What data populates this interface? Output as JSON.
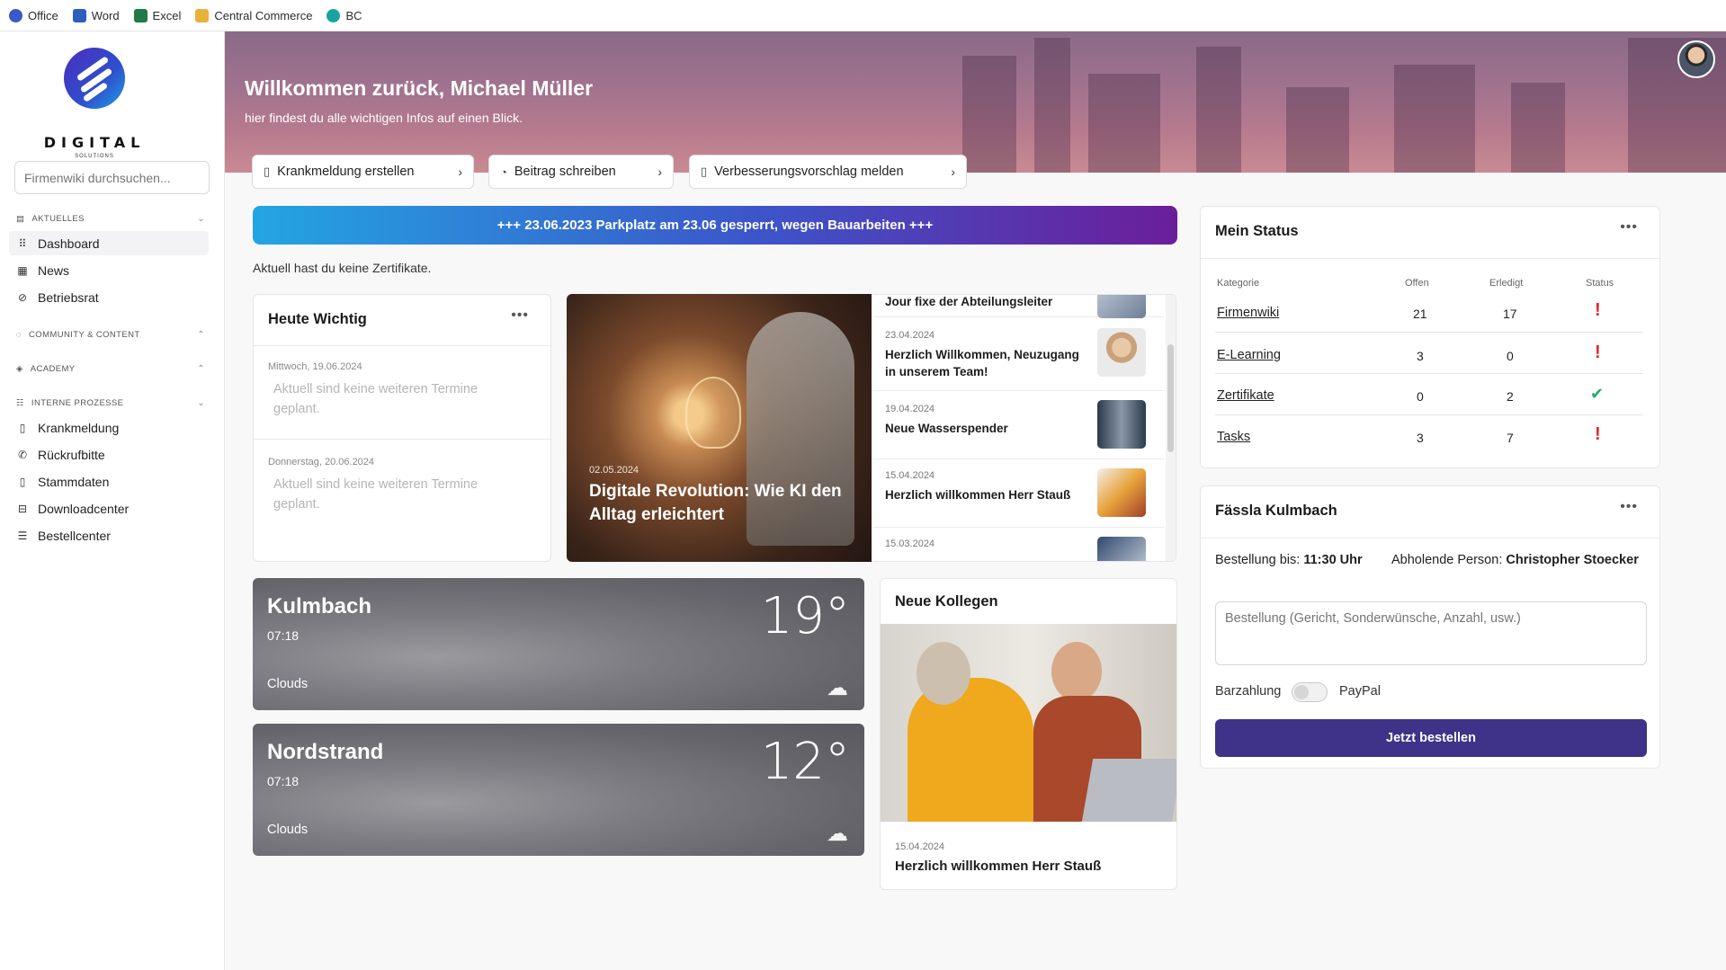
{
  "bookmarks": [
    {
      "label": "Office",
      "icon": "office-icon",
      "color": "#3b57c8"
    },
    {
      "label": "Word",
      "icon": "word-icon",
      "color": "#2b5fbe"
    },
    {
      "label": "Excel",
      "icon": "excel-icon",
      "color": "#1f7a45"
    },
    {
      "label": "Central Commerce",
      "icon": "folder-icon",
      "color": "#e8b23a"
    },
    {
      "label": "BC",
      "icon": "globe-icon",
      "color": "#1aa3a3"
    }
  ],
  "sidebar": {
    "logo_text": "DIGITAL",
    "logo_sub": "SOLUTIONS",
    "search_placeholder": "Firmenwiki durchsuchen...",
    "sections": [
      {
        "label": "AKTUELLES",
        "items": [
          "Dashboard",
          "News",
          "Betriebsrat"
        ]
      },
      {
        "label": "COMMUNITY & CONTENT",
        "items": []
      },
      {
        "label": "ACADEMY",
        "items": []
      },
      {
        "label": "INTERNE PROZESSE",
        "items": [
          "Krankmeldung",
          "Rückrufbitte",
          "Stammdaten",
          "Downloadcenter",
          "Bestellcenter"
        ]
      }
    ],
    "active_item": "Dashboard"
  },
  "hero": {
    "title": "Willkommen zurück, Michael Müller",
    "subtitle": "hier findest du alle wichtigen Infos auf einen Blick."
  },
  "quick_actions": [
    {
      "label": "Krankmeldung erstellen",
      "icon": "document-icon"
    },
    {
      "label": "Beitrag schreiben",
      "icon": "chat-icon"
    },
    {
      "label": "Verbesserungsvorschlag melden",
      "icon": "document-icon"
    }
  ],
  "announcement": "+++ 23.06.2023 Parkplatz am 23.06 gesperrt, wegen Bauarbeiten +++",
  "certificates_note": "Aktuell hast du keine Zertifikate.",
  "heute_wichtig": {
    "title": "Heute Wichtig",
    "entries": [
      {
        "date": "Mittwoch, 19.06.2024",
        "text": "Aktuell sind keine weiteren Termine geplant."
      },
      {
        "date": "Donnerstag, 20.06.2024",
        "text": "Aktuell sind keine weiteren Termine geplant."
      }
    ]
  },
  "news": {
    "featured": {
      "date": "02.05.2024",
      "title": "Digitale Revolution: Wie KI den Alltag erleichtert"
    },
    "items": [
      {
        "date": "",
        "title": "Jour fixe der Abteilungsleiter"
      },
      {
        "date": "23.04.2024",
        "title": "Herzlich Willkommen, Neuzugang in unserem Team!"
      },
      {
        "date": "19.04.2024",
        "title": "Neue Wasserspender"
      },
      {
        "date": "15.04.2024",
        "title": "Herzlich willkommen Herr Stauß"
      },
      {
        "date": "15.03.2024",
        "title": ""
      }
    ]
  },
  "weather": [
    {
      "city": "Kulmbach",
      "time": "07:18",
      "condition": "Clouds",
      "temp": "19°"
    },
    {
      "city": "Nordstrand",
      "time": "07:18",
      "condition": "Clouds",
      "temp": "12°"
    }
  ],
  "neue_kollegen": {
    "title": "Neue Kollegen",
    "date": "15.04.2024",
    "name": "Herzlich willkommen Herr Stauß"
  },
  "status": {
    "title": "Mein Status",
    "headers": {
      "category": "Kategorie",
      "open": "Offen",
      "done": "Erledigt",
      "status": "Status"
    },
    "rows": [
      {
        "category": "Firmenwiki",
        "open": "21",
        "done": "17",
        "ok": false
      },
      {
        "category": "E-Learning",
        "open": "3",
        "done": "0",
        "ok": false
      },
      {
        "category": "Zertifikate",
        "open": "0",
        "done": "2",
        "ok": true
      },
      {
        "category": "Tasks",
        "open": "3",
        "done": "7",
        "ok": false
      }
    ],
    "colors": {
      "bad": "#e0282e",
      "ok": "#27ae60"
    }
  },
  "order": {
    "title": "Fässla Kulmbach",
    "deadline_label": "Bestellung bis:",
    "deadline_value": "11:30 Uhr",
    "pickup_label": "Abholende Person:",
    "pickup_value": "Christopher Stoecker",
    "placeholder": "Bestellung (Gericht, Sonderwünsche, Anzahl, usw.)",
    "pay_left": "Barzahlung",
    "pay_right": "PayPal",
    "button": "Jetzt bestellen",
    "accent": "#3f3289"
  }
}
